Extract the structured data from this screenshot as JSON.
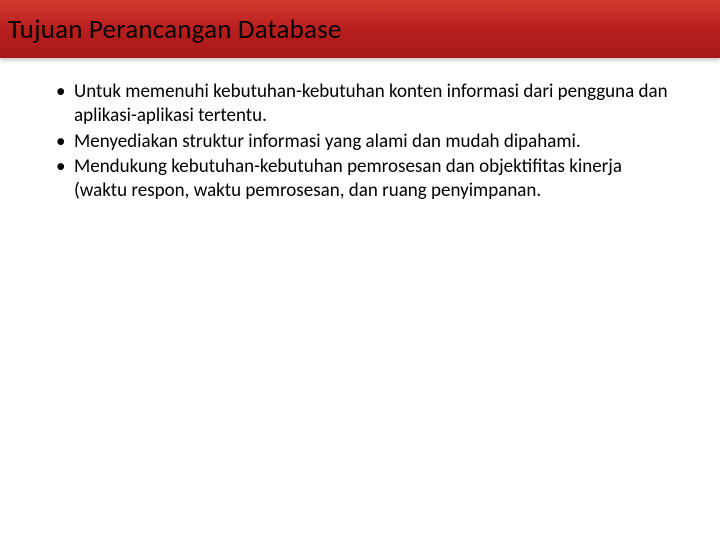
{
  "slide": {
    "title": "Tujuan Perancangan Database",
    "bullets": [
      "Untuk  memenuhi  kebutuhan-kebutuhan  konten informasi dari pengguna  dan aplikasi-aplikasi tertentu.",
      "Menyediakan struktur informasi yang alami dan mudah dipahami.",
      "Mendukung  kebutuhan-kebutuhan  pemrosesan  dan objektifitas  kinerja (waktu respon, waktu pemrosesan, dan ruang penyimpanan."
    ]
  }
}
